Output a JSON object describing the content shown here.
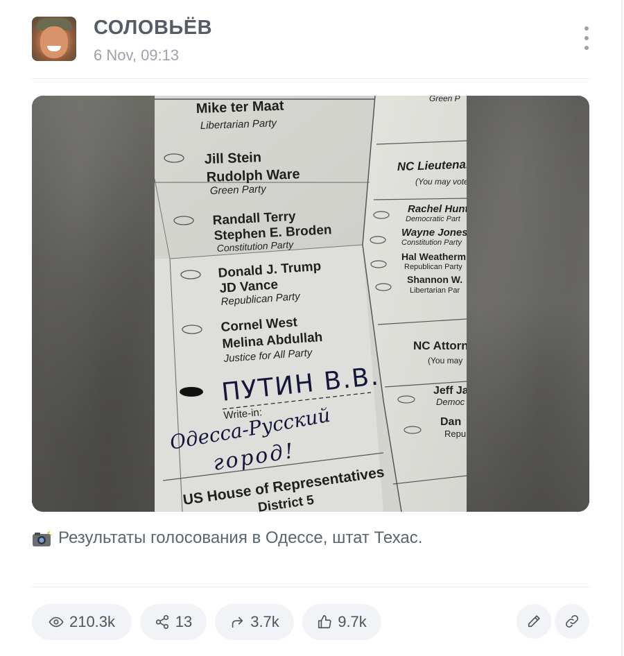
{
  "post": {
    "channel_name": "СОЛОВЬЁВ",
    "date": "6 Nov, 09:13",
    "caption": "Результаты голосования в Одессе, штат Техас."
  },
  "ballot": {
    "left_column": [
      {
        "names": [
          "Mike ter Maat"
        ],
        "party": "Libertarian Party"
      },
      {
        "names": [
          "Jill Stein",
          "Rudolph Ware"
        ],
        "party": "Green Party"
      },
      {
        "names": [
          "Randall Terry",
          "Stephen E. Broden"
        ],
        "party": "Constitution Party"
      },
      {
        "names": [
          "Donald J. Trump",
          "JD Vance"
        ],
        "party": "Republican Party"
      },
      {
        "names": [
          "Cornel West",
          "Melina Abdullah"
        ],
        "party": "Justice for All Party"
      }
    ],
    "write_in_handwritten": "ПУТИН В.В.",
    "write_in_label": "Write-in:",
    "handwritten_note_line1": "Одесса-Русский",
    "handwritten_note_line2": "город!",
    "footer_line1": "US House of Representatives",
    "footer_line2": "District 5",
    "right_column": {
      "top_party": "Green P",
      "section1_title": "NC Lieutenan",
      "section1_note": "(You may vote",
      "section1_candidates": [
        {
          "name": "Rachel Hunt",
          "party": "Democratic Part"
        },
        {
          "name": "Wayne Jones",
          "party": "Constitution Party"
        },
        {
          "name": "Hal Weatherm",
          "party": "Republican Party"
        },
        {
          "name": "Shannon W.",
          "party": "Libertarian Par"
        }
      ],
      "section2_title": "NC Attorn",
      "section2_note": "(You may",
      "section2_candidates": [
        {
          "name": "Jeff Ja",
          "party": "Democ"
        },
        {
          "name": "Dan",
          "party": "Repu"
        }
      ]
    }
  },
  "stats": {
    "views": "210.3k",
    "shares": "13",
    "forwards": "3.7k",
    "reactions": "9.7k"
  },
  "icons": {
    "views": "eye-icon",
    "shares": "share-icon",
    "forwards": "forward-arrow-icon",
    "reactions": "thumbs-up-icon",
    "edit": "pencil-icon",
    "link": "link-icon",
    "menu": "more-vertical-icon",
    "caption_emoji": "camera-flash-icon"
  },
  "colors": {
    "pill_bg": "#f1f3f6",
    "icon": "#4b5560",
    "muted_text": "#9aa3ad"
  }
}
